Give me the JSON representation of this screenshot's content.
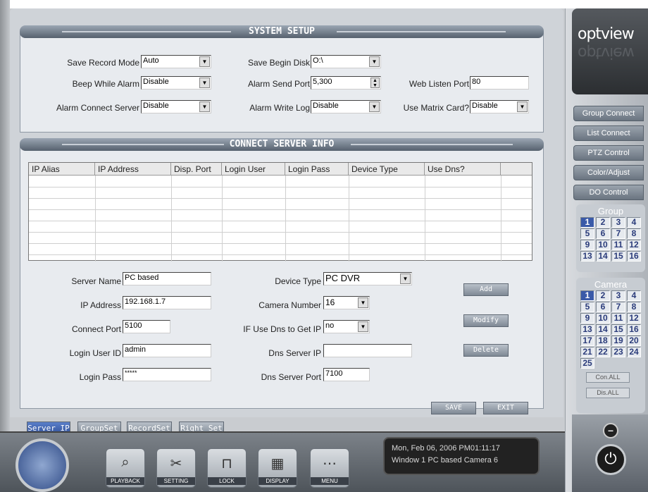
{
  "system_setup": {
    "title": "SYSTEM SETUP",
    "save_record_mode": {
      "label": "Save Record Mode",
      "value": "Auto"
    },
    "save_begin_disk": {
      "label": "Save Begin Disk",
      "value": "O:\\"
    },
    "beep_while_alarm": {
      "label": "Beep While Alarm",
      "value": "Disable"
    },
    "alarm_send_port": {
      "label": "Alarm Send Port",
      "value": "5,300"
    },
    "web_listen_port": {
      "label": "Web Listen Port",
      "value": "80"
    },
    "alarm_connect_server": {
      "label": "Alarm Connect Server",
      "value": "Disable"
    },
    "alarm_write_log": {
      "label": "Alarm Write Log",
      "value": "Disable"
    },
    "use_matrix_card": {
      "label": "Use Matrix Card?",
      "value": "Disable"
    }
  },
  "connect_server_info": {
    "title": "CONNECT SERVER INFO",
    "columns": [
      "IP Alias",
      "IP Address",
      "Disp. Port",
      "Login User",
      "Login Pass",
      "Device Type",
      "Use Dns?"
    ]
  },
  "form": {
    "server_name": {
      "label": "Server Name",
      "value": "PC based"
    },
    "ip_address": {
      "label": "IP Address",
      "value": "192.168.1.7"
    },
    "connect_port": {
      "label": "Connect Port",
      "value": "5100"
    },
    "login_user_id": {
      "label": "Login User ID",
      "value": "admin"
    },
    "login_pass": {
      "label": "Login Pass",
      "value": "*****"
    },
    "device_type": {
      "label": "Device Type",
      "value": "PC DVR"
    },
    "camera_number": {
      "label": "Camera Number",
      "value": "16"
    },
    "use_dns": {
      "label": "IF Use Dns to Get IP",
      "value": "no"
    },
    "dns_server_ip": {
      "label": "Dns Server IP",
      "value": ""
    },
    "dns_server_port": {
      "label": "Dns Server Port",
      "value": "7100"
    }
  },
  "actions": {
    "add": "Add",
    "modify": "Modify",
    "delete": "Delete",
    "save": "SAVE",
    "exit": "EXIT"
  },
  "tabs": [
    "Server IP",
    "GroupSet",
    "RecordSet",
    "Right Set"
  ],
  "brand": {
    "logo": "optview"
  },
  "side_menu": [
    "Group Connect",
    "List Connect",
    "PTZ Control",
    "Color/Adjust",
    "DO Control"
  ],
  "group": {
    "title": "Group",
    "numbers": [
      "1",
      "2",
      "3",
      "4",
      "5",
      "6",
      "7",
      "8",
      "9",
      "10",
      "11",
      "12",
      "13",
      "14",
      "15",
      "16"
    ],
    "active": "1"
  },
  "camera": {
    "title": "Camera",
    "numbers": [
      "1",
      "2",
      "3",
      "4",
      "5",
      "6",
      "7",
      "8",
      "9",
      "10",
      "11",
      "12",
      "13",
      "14",
      "15",
      "16",
      "17",
      "18",
      "19",
      "20",
      "21",
      "22",
      "23",
      "24",
      "25"
    ],
    "active": "1"
  },
  "side_small": {
    "con_all": "Con.ALL",
    "dis_all": "Dis.ALL"
  },
  "toolbar": [
    "PLAYBACK",
    "SETTING",
    "LOCK",
    "DISPLAY",
    "MENU"
  ],
  "status": {
    "line1": "Mon, Feb 06, 2006   PM01:11:17",
    "line2": "Window 1  PC based Camera 6"
  },
  "colors": {
    "accent": "#3a5aa8",
    "header": "#56616e"
  }
}
